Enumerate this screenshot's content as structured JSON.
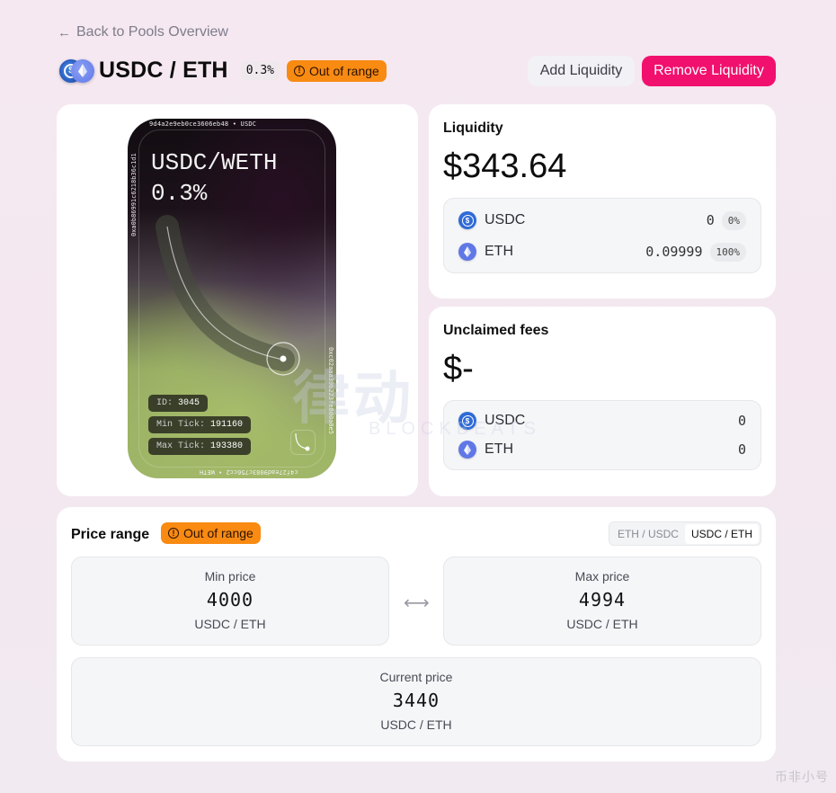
{
  "nav": {
    "back_label": "Back to Pools Overview",
    "back_icon": "arrow-left-icon"
  },
  "header": {
    "pair": "USDC / ETH",
    "fee_tier": "0.3%",
    "status": "Out of range",
    "status_color": "#f98a12",
    "tokens": [
      "USDC",
      "ETH"
    ]
  },
  "actions": {
    "add_liquidity": "Add Liquidity",
    "remove_liquidity": "Remove Liquidity",
    "remove_color": "#f2106e"
  },
  "nft": {
    "title_line1": "USDC/WETH",
    "title_line2": "0.3%",
    "address_top": "9d4a2e9eb0ce3606eb48 • USDC",
    "address_left": "0xa0b86991c6218b36c1d1",
    "address_right": "0xc02aaa39b223fe8d0a0e5",
    "address_bottom": "c4f27ead9083c756cc2 • WETH",
    "id_label": "ID:",
    "id_value": "3045",
    "min_tick_label": "Min Tick:",
    "min_tick_value": "191160",
    "max_tick_label": "Max Tick:",
    "max_tick_value": "193380"
  },
  "liquidity": {
    "label": "Liquidity",
    "value": "$343.64",
    "tokens": [
      {
        "symbol": "USDC",
        "amount": "0",
        "percent": "0%"
      },
      {
        "symbol": "ETH",
        "amount": "0.09999",
        "percent": "100%"
      }
    ]
  },
  "fees": {
    "label": "Unclaimed fees",
    "value": "$-",
    "tokens": [
      {
        "symbol": "USDC",
        "amount": "0"
      },
      {
        "symbol": "ETH",
        "amount": "0"
      }
    ]
  },
  "price_range": {
    "title": "Price range",
    "status": "Out of range",
    "toggle_options": [
      "ETH / USDC",
      "USDC / ETH"
    ],
    "toggle_selected": "USDC / ETH",
    "min": {
      "label": "Min price",
      "value": "4000",
      "unit": "USDC / ETH"
    },
    "max": {
      "label": "Max price",
      "value": "4994",
      "unit": "USDC / ETH"
    },
    "current": {
      "label": "Current price",
      "value": "3440",
      "unit": "USDC / ETH"
    }
  },
  "watermark": {
    "main": "律动",
    "sub": "BLOCKBEATS",
    "corner": "币非小号"
  }
}
